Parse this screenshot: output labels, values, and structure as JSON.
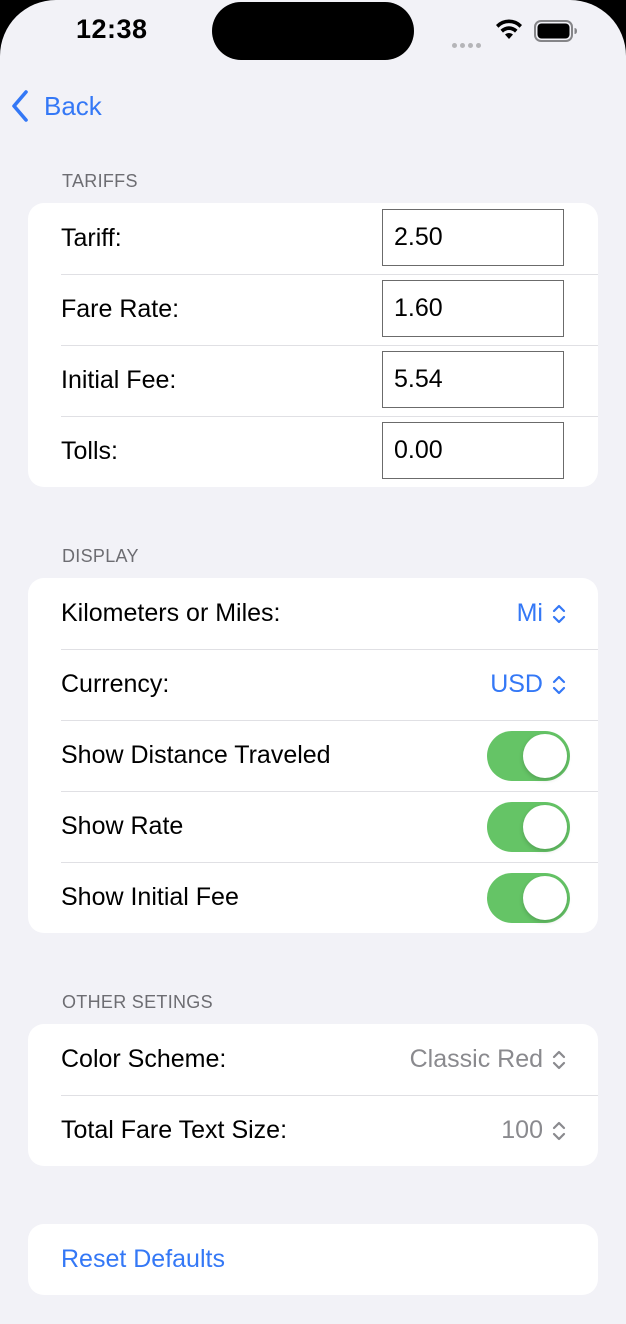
{
  "status_bar": {
    "time": "12:38",
    "icons": [
      "cellular-dots-icon",
      "wifi-icon",
      "battery-icon"
    ]
  },
  "nav": {
    "back_label": "Back",
    "back_icon": "chevron-left-icon"
  },
  "colors": {
    "accent": "#3478f6",
    "toggle_on": "#65c466",
    "background": "#f2f2f7",
    "secondary_text": "#8a8a8e"
  },
  "tariffs": {
    "header": "TARIFFS",
    "rows": [
      {
        "label": "Tariff:",
        "value": "2.50"
      },
      {
        "label": "Fare Rate:",
        "value": "1.60"
      },
      {
        "label": "Initial Fee:",
        "value": "5.54"
      },
      {
        "label": "Tolls:",
        "value": "0.00"
      }
    ]
  },
  "display": {
    "header": "DISPLAY",
    "pickers": [
      {
        "label": "Kilometers or Miles:",
        "value": "Mi",
        "icon": "chevron-up-down-icon"
      },
      {
        "label": "Currency:",
        "value": "USD",
        "icon": "chevron-up-down-icon"
      }
    ],
    "toggles": [
      {
        "label": "Show Distance Traveled",
        "on": true
      },
      {
        "label": "Show Rate",
        "on": true
      },
      {
        "label": "Show Initial Fee",
        "on": true
      }
    ]
  },
  "other": {
    "header": "OTHER SETINGS",
    "pickers": [
      {
        "label": "Color Scheme:",
        "value": "Classic Red",
        "icon": "chevron-up-down-icon"
      },
      {
        "label": "Total Fare Text Size:",
        "value": "100",
        "icon": "chevron-up-down-icon"
      }
    ]
  },
  "reset": {
    "label": "Reset Defaults"
  }
}
